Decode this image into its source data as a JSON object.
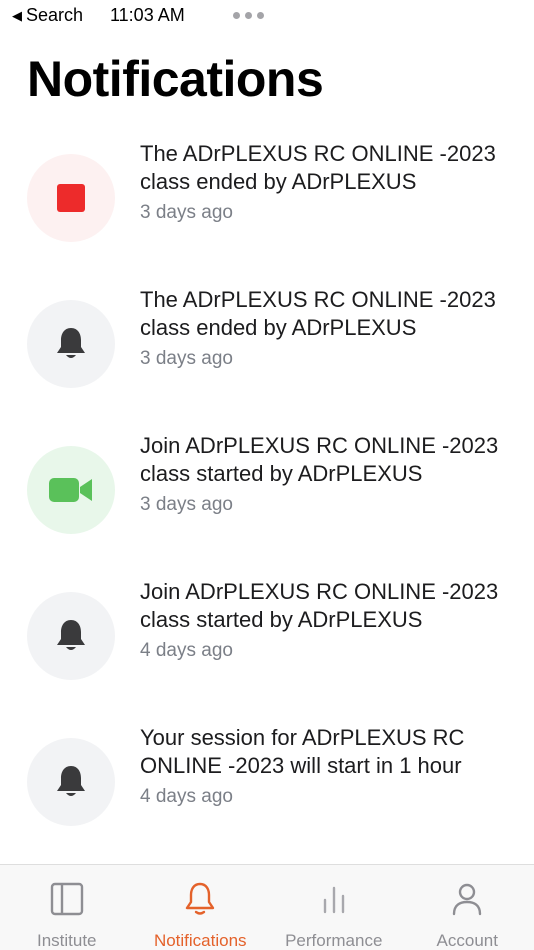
{
  "status_bar": {
    "back_label": "Search",
    "time": "11:03 AM"
  },
  "header": {
    "title": "Notifications"
  },
  "notifications": [
    {
      "icon": "stop-icon",
      "message": "The ADrPLEXUS RC ONLINE -2023 class ended by ADrPLEXUS",
      "time": "3 days ago"
    },
    {
      "icon": "bell-icon",
      "message": "The ADrPLEXUS RC ONLINE -2023 class ended by ADrPLEXUS",
      "time": "3 days ago"
    },
    {
      "icon": "video-camera-icon",
      "message": "Join ADrPLEXUS RC ONLINE -2023 class started by ADrPLEXUS",
      "time": "3 days ago"
    },
    {
      "icon": "bell-icon",
      "message": "Join ADrPLEXUS RC ONLINE -2023 class started by ADrPLEXUS",
      "time": "4 days ago"
    },
    {
      "icon": "bell-icon",
      "message": "Your session for ADrPLEXUS RC ONLINE -2023 will start in 1 hour",
      "time": "4 days ago"
    }
  ],
  "tab_bar": {
    "active": "Notifications",
    "tabs": [
      {
        "label": "Institute",
        "icon": "institute-icon"
      },
      {
        "label": "Notifications",
        "icon": "bell-icon"
      },
      {
        "label": "Performance",
        "icon": "performance-icon"
      },
      {
        "label": "Account",
        "icon": "account-icon"
      }
    ]
  },
  "colors": {
    "accent": "#e4622b",
    "stop_red": "#ed2b2b",
    "video_green": "#5ac15a",
    "bell_gray": "#3a3a3c",
    "timestamp_gray": "#7b7f87"
  }
}
